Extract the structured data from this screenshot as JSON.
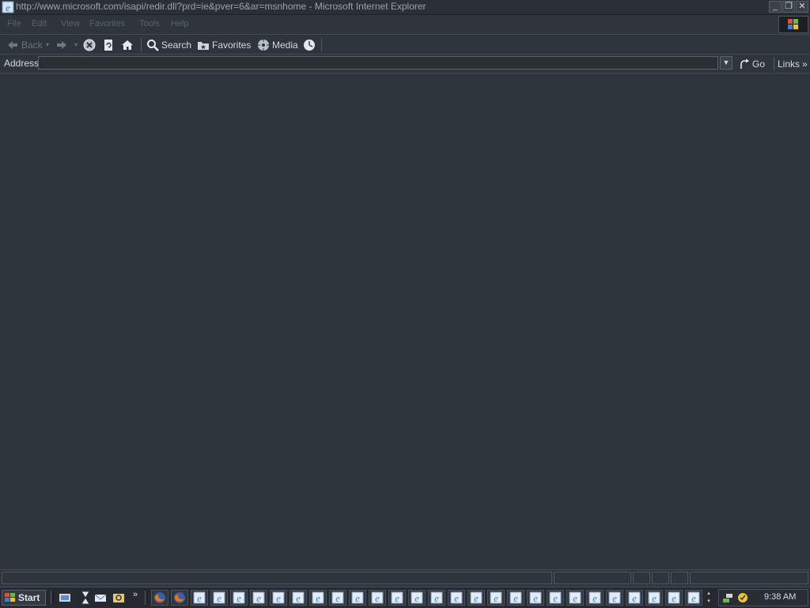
{
  "window": {
    "title": "http://www.microsoft.com/isapi/redir.dll?prd=ie&pver=6&ar=msnhome - Microsoft Internet Explorer",
    "controls": {
      "minimize": "_",
      "restore": "❐",
      "close": "✕"
    }
  },
  "menu": {
    "items": [
      "File",
      "Edit",
      "View",
      "Favorites",
      "Tools",
      "Help"
    ]
  },
  "toolbar": {
    "back_label": "Back",
    "search_label": "Search",
    "favorites_label": "Favorites",
    "media_label": "Media"
  },
  "address": {
    "label": "Address",
    "value": "",
    "go_label": "Go",
    "links_label": "Links",
    "links_chevron": "»"
  },
  "taskbar": {
    "start_label": "Start",
    "clock": "9:38 AM",
    "chevron": "»"
  },
  "colors": {
    "background": "#2f353d",
    "ie_blue": "#3b7fd4",
    "firefox_orange": "#e8741c"
  }
}
